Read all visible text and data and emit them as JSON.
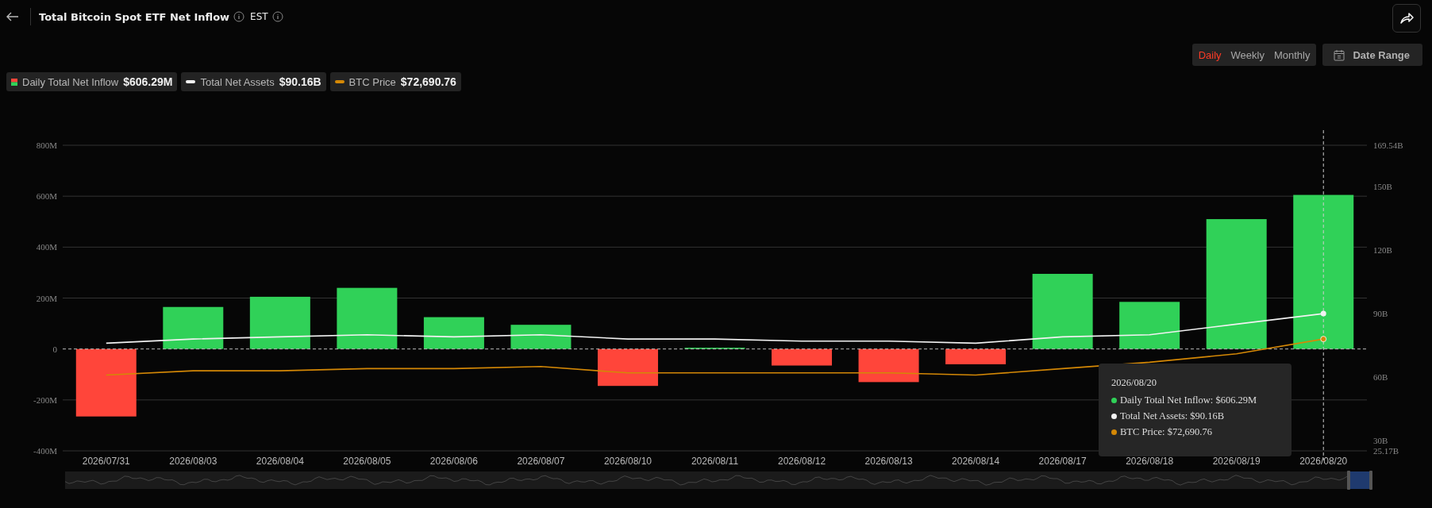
{
  "header": {
    "title": "Total Bitcoin Spot ETF Net Inflow",
    "timezone": "EST"
  },
  "periods": [
    {
      "label": "Daily",
      "selected": true
    },
    {
      "label": "Weekly",
      "selected": false
    },
    {
      "label": "Monthly",
      "selected": false
    }
  ],
  "date_range": {
    "label": "Date Range"
  },
  "legend": [
    {
      "kind": "bar",
      "value": "$606.29M"
    },
    {
      "kind": "line",
      "value": "$90.16B"
    },
    {
      "kind": "line",
      "value": "$72,690.76"
    }
  ],
  "chart": {
    "chart_data": {
      "type": "bar",
      "categories": [
        "2026/07/31",
        "2026/08/03",
        "2026/08/04",
        "2026/08/05",
        "2026/08/06",
        "2026/08/07",
        "2026/08/10",
        "2026/08/11",
        "2026/08/12",
        "2026/08/13",
        "2026/08/14",
        "2026/08/17",
        "2026/08/18",
        "2026/08/19",
        "2026/08/20"
      ],
      "series": [
        {
          "name": "Daily Total Net Inflow",
          "type": "bar",
          "color": "#30d158",
          "colors": [
            "#ff453a",
            "#30d158",
            "#30d158",
            "#30d158",
            "#30d158",
            "#30d158",
            "#ff453a",
            "#30d158",
            "#ff453a",
            "#ff453a",
            "#ff453a",
            "#30d158",
            "#30d158",
            "#30d158",
            "#30d158"
          ],
          "values": [
            -265,
            165,
            205,
            240,
            125,
            95,
            -145,
            5,
            -65,
            -130,
            -60,
            295,
            185,
            510,
            605
          ]
        },
        {
          "name": "Total Net Assets",
          "type": "line",
          "axis": "y2",
          "color": "#f2f2f2",
          "values": [
            76,
            78,
            79,
            80,
            79,
            80,
            78,
            78,
            77,
            77,
            76,
            79,
            80,
            85,
            90
          ]
        },
        {
          "name": "BTC Price",
          "type": "line",
          "axis": "y2",
          "color": "#d48806",
          "values": [
            61,
            63,
            63,
            64,
            64,
            65,
            62,
            62,
            62,
            62,
            61,
            64,
            67,
            71,
            78
          ]
        }
      ],
      "grid": true,
      "ref_lines": [
        {
          "axis": "y",
          "value": 0
        },
        {
          "axis": "x",
          "value": "2026/08/20"
        }
      ],
      "ylim": [
        -400,
        800
      ],
      "yticks": [
        {
          "value": -400,
          "label": "-400M"
        },
        {
          "value": -200,
          "label": "-200M"
        },
        {
          "value": 0,
          "label": "0"
        },
        {
          "value": 200,
          "label": "200M"
        },
        {
          "value": 400,
          "label": "400M"
        },
        {
          "value": 600,
          "label": "600M"
        },
        {
          "value": 800,
          "label": "800M"
        }
      ],
      "y2lim": [
        25.17,
        169.54
      ],
      "y2ticks": [
        {
          "value": 25.17,
          "label": "25.17B"
        },
        {
          "value": 30,
          "label": "30B"
        },
        {
          "value": 60,
          "label": "60B"
        },
        {
          "value": 90,
          "label": "90B"
        },
        {
          "value": 120,
          "label": "120B"
        },
        {
          "value": 150,
          "label": "150B"
        },
        {
          "value": 169.54,
          "label": "169.54B"
        }
      ]
    }
  },
  "tooltip": {
    "date": "2026/08/20",
    "rows": [
      {
        "label": "Daily Total Net Inflow: $606.29M",
        "color": "#30d158"
      },
      {
        "label": "Total Net Assets: $90.16B",
        "color": "#f2f2f2"
      },
      {
        "label": "BTC Price: $72,690.76",
        "color": "#d48806"
      }
    ]
  }
}
